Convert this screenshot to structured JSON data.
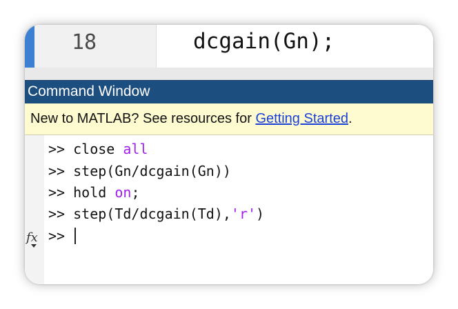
{
  "editor": {
    "line_number": "18",
    "code": "dcgain(Gn);"
  },
  "command_window": {
    "title": "Command Window",
    "info_text": "New to MATLAB? See resources for ",
    "info_link": "Getting Started",
    "info_suffix": ".",
    "prompt": ">>",
    "fx_label": "fx",
    "history": [
      {
        "prefix": "close ",
        "keyword": "all",
        "suffix": ""
      },
      {
        "prefix": "step(Gn/dcgain(Gn))",
        "keyword": "",
        "suffix": ""
      },
      {
        "prefix": "hold ",
        "keyword": "on",
        "suffix": ";"
      },
      {
        "prefix": "step(Td/dcgain(Td),",
        "keyword": "'r'",
        "suffix": ")"
      }
    ]
  },
  "colors": {
    "title_bar": "#1c4e80",
    "info_bar": "#fffbd0",
    "link": "#1a3fd6",
    "keyword": "#a020f0",
    "editor_accent": "#3d7fd0"
  }
}
